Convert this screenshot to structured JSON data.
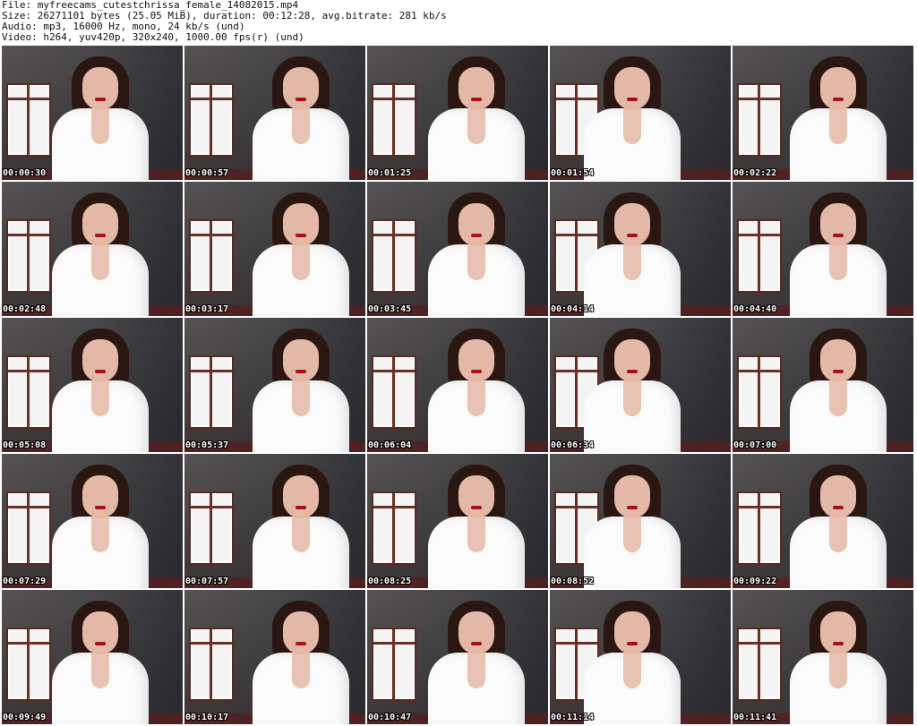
{
  "header": {
    "line1": "File: myfreecams_cutestchrissa_female_14082015.mp4",
    "line2": "Size: 26271101 bytes (25.05 MiB), duration: 00:12:28, avg.bitrate: 281 kb/s",
    "line3": "Audio: mp3, 16000 Hz, mono, 24 kb/s (und)",
    "line4": "Video: h264, yuv420p, 320x240, 1000.00 fps(r) (und)"
  },
  "thumbnails": [
    {
      "timestamp": "00:00:30"
    },
    {
      "timestamp": "00:00:57"
    },
    {
      "timestamp": "00:01:25"
    },
    {
      "timestamp": "00:01:54"
    },
    {
      "timestamp": "00:02:22"
    },
    {
      "timestamp": "00:02:48"
    },
    {
      "timestamp": "00:03:17"
    },
    {
      "timestamp": "00:03:45"
    },
    {
      "timestamp": "00:04:14"
    },
    {
      "timestamp": "00:04:40"
    },
    {
      "timestamp": "00:05:08"
    },
    {
      "timestamp": "00:05:37"
    },
    {
      "timestamp": "00:06:04"
    },
    {
      "timestamp": "00:06:34"
    },
    {
      "timestamp": "00:07:00"
    },
    {
      "timestamp": "00:07:29"
    },
    {
      "timestamp": "00:07:57"
    },
    {
      "timestamp": "00:08:25"
    },
    {
      "timestamp": "00:08:52"
    },
    {
      "timestamp": "00:09:22"
    },
    {
      "timestamp": "00:09:49"
    },
    {
      "timestamp": "00:10:17"
    },
    {
      "timestamp": "00:10:47"
    },
    {
      "timestamp": "00:11:14"
    },
    {
      "timestamp": "00:11:41"
    }
  ]
}
